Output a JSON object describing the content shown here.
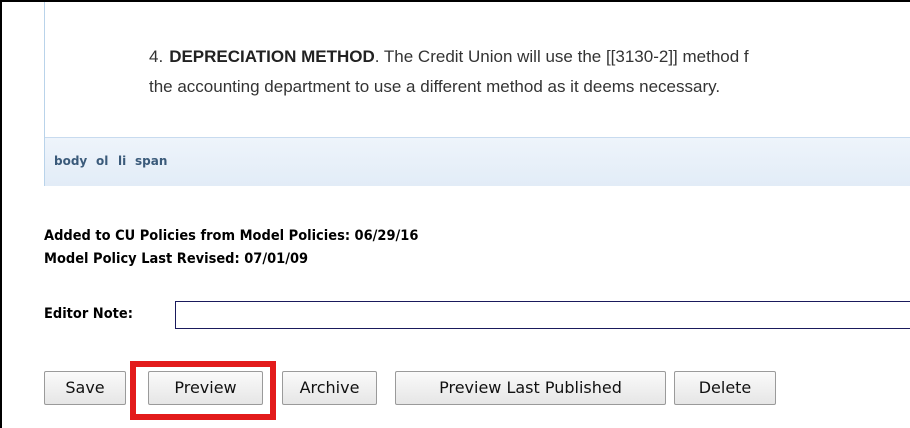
{
  "editor": {
    "item_number": "4.",
    "item_heading": "DEPRECIATION METHOD",
    "item_line1_rest": ". The Credit Union will use the [[3130-2]] method f",
    "item_line2": "the accounting department to use a different method as it deems necessary.",
    "path": [
      "body",
      "ol",
      "li",
      "span"
    ]
  },
  "meta": {
    "added_line": "Added to CU Policies from Model Policies: 06/29/16",
    "revised_line": "Model Policy Last Revised: 07/01/09"
  },
  "editor_note": {
    "label": "Editor Note:",
    "value": ""
  },
  "buttons": {
    "save": "Save",
    "preview": "Preview",
    "archive": "Archive",
    "preview_last_published": "Preview Last Published",
    "delete": "Delete"
  },
  "colors": {
    "highlight": "#e31b1b",
    "editor_border": "#b9d3ea",
    "pathbar": "#e2ecf7"
  }
}
